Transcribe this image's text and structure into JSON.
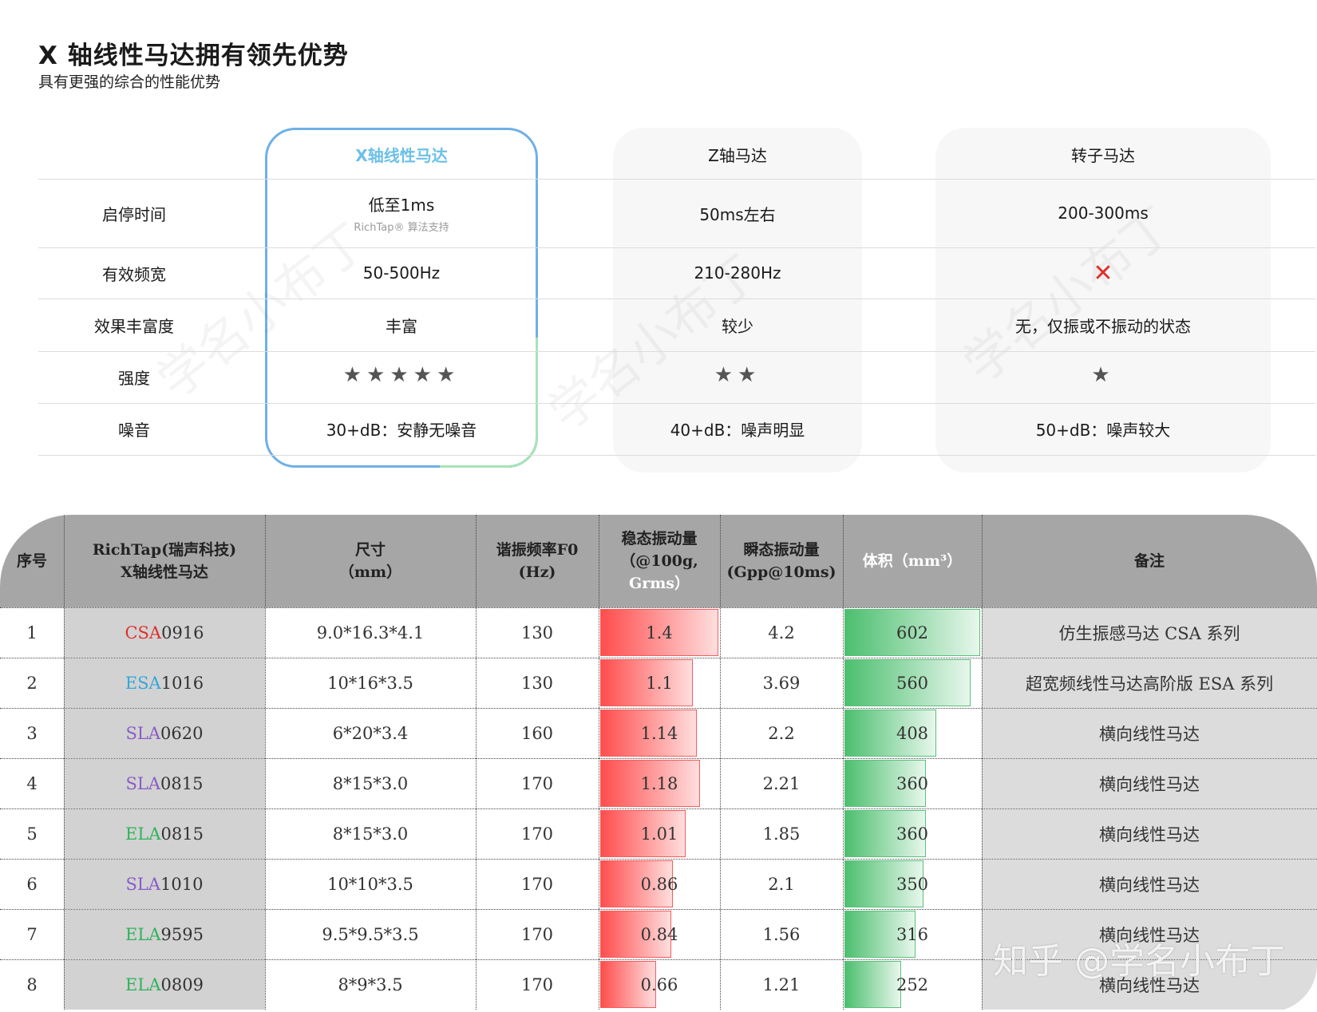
{
  "header": {
    "title": "X 轴线性马达拥有领先优势",
    "subtitle": "具有更强的综合的性能优势"
  },
  "comparison": {
    "columns": [
      {
        "name": "X轴线性马达",
        "highlight": true
      },
      {
        "name": "Z轴马达",
        "highlight": false
      },
      {
        "name": "转子马达",
        "highlight": false
      }
    ],
    "rows": [
      {
        "label": "启停时间",
        "values": [
          "低至1ms",
          "50ms左右",
          "200-300ms"
        ],
        "note": "RichTap® 算法支持"
      },
      {
        "label": "有效频宽",
        "values": [
          "50-500Hz",
          "210-280Hz",
          ""
        ],
        "cross_icon": "cross-icon"
      },
      {
        "label": "效果丰富度",
        "values": [
          "丰富",
          "较少",
          "无，仅振或不振动的状态"
        ]
      },
      {
        "label": "强度",
        "stars": [
          5,
          2,
          1
        ]
      },
      {
        "label": "噪音",
        "values": [
          "30+dB：安静无噪音",
          "40+dB：噪声明显",
          "50+dB：噪声较大"
        ]
      }
    ]
  },
  "spec_table": {
    "headers": {
      "index": "序号",
      "model_l1": "RichTap(瑞声科技)",
      "model_l2": "X轴线性马达",
      "size_l1": "尺寸",
      "size_l2": "（mm）",
      "f0_l1": "谐振频率F0",
      "f0_l2": "(Hz)",
      "steady_l1": "稳态振动量",
      "steady_l2": "（@100g,",
      "steady_l3": "Grms）",
      "transient_l1": "瞬态振动量",
      "transient_l2": "(Gpp@10ms)",
      "volume": "体积（mm³）",
      "remark": "备注"
    },
    "rows": [
      {
        "index": "1",
        "prefix": "CSA",
        "num": "0916",
        "prefix_color": "#e0302c",
        "size": "9.0*16.3*4.1",
        "f0": "130",
        "steady": "1.4",
        "steady_v": 1.4,
        "transient": "4.2",
        "volume": "602",
        "volume_v": 602,
        "remark": "仿生振感马达 CSA 系列"
      },
      {
        "index": "2",
        "prefix": "ESA",
        "num": "1016",
        "prefix_color": "#35a7d8",
        "size": "10*16*3.5",
        "f0": "130",
        "steady": "1.1",
        "steady_v": 1.1,
        "transient": "3.69",
        "volume": "560",
        "volume_v": 560,
        "remark": "超宽频线性马达高阶版 ESA 系列"
      },
      {
        "index": "3",
        "prefix": "SLA",
        "num": "0620",
        "prefix_color": "#8a5cc8",
        "size": "6*20*3.4",
        "f0": "160",
        "steady": "1.14",
        "steady_v": 1.14,
        "transient": "2.2",
        "volume": "408",
        "volume_v": 408,
        "remark": "横向线性马达"
      },
      {
        "index": "4",
        "prefix": "SLA",
        "num": "0815",
        "prefix_color": "#8a5cc8",
        "size": "8*15*3.0",
        "f0": "170",
        "steady": "1.18",
        "steady_v": 1.18,
        "transient": "2.21",
        "volume": "360",
        "volume_v": 360,
        "remark": "横向线性马达"
      },
      {
        "index": "5",
        "prefix": "ELA",
        "num": "0815",
        "prefix_color": "#2fb35a",
        "size": "8*15*3.0",
        "f0": "170",
        "steady": "1.01",
        "steady_v": 1.01,
        "transient": "1.85",
        "volume": "360",
        "volume_v": 360,
        "remark": "横向线性马达"
      },
      {
        "index": "6",
        "prefix": "SLA",
        "num": "1010",
        "prefix_color": "#8a5cc8",
        "size": "10*10*3.5",
        "f0": "170",
        "steady": "0.86",
        "steady_v": 0.86,
        "transient": "2.1",
        "volume": "350",
        "volume_v": 350,
        "remark": "横向线性马达"
      },
      {
        "index": "7",
        "prefix": "ELA",
        "num": "9595",
        "prefix_color": "#2fb35a",
        "size": "9.5*9.5*3.5",
        "f0": "170",
        "steady": "0.84",
        "steady_v": 0.84,
        "transient": "1.56",
        "volume": "316",
        "volume_v": 316,
        "remark": "横向线性马达"
      },
      {
        "index": "8",
        "prefix": "ELA",
        "num": "0809",
        "prefix_color": "#2fb35a",
        "size": "8*9*3.5",
        "f0": "170",
        "steady": "0.66",
        "steady_v": 0.66,
        "transient": "1.21",
        "volume": "252",
        "volume_v": 252,
        "remark": "横向线性马达"
      }
    ]
  },
  "watermark": {
    "text": "学名小布丁",
    "corner_text": "知乎 @学名小布丁"
  }
}
